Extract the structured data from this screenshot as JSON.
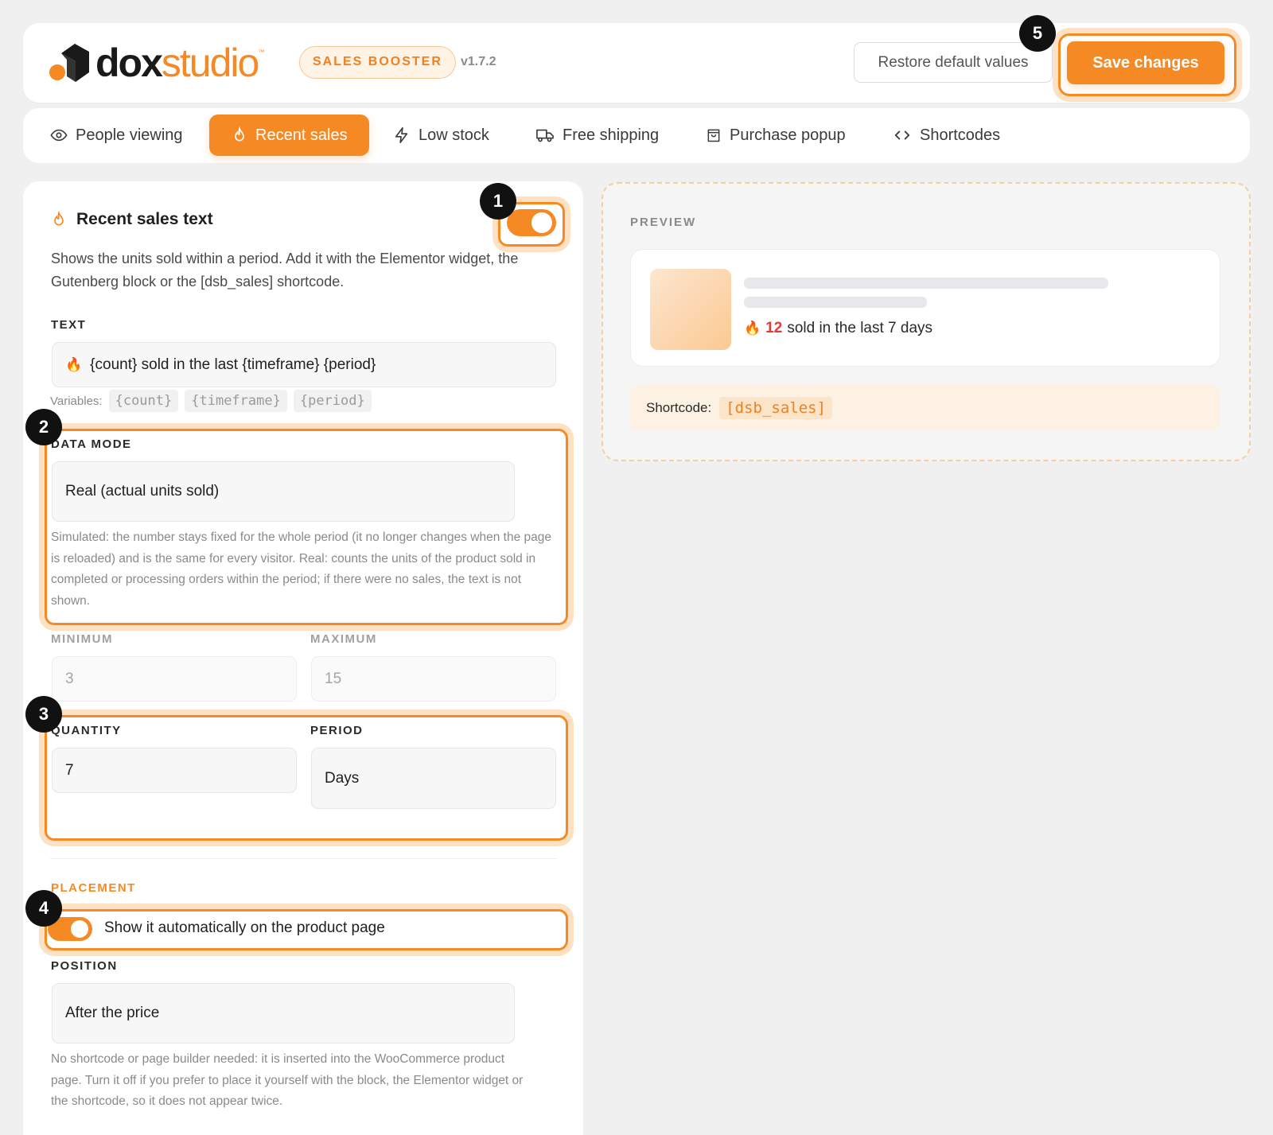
{
  "header": {
    "logo_dox": "dox",
    "logo_studio": "studio",
    "badge": "SALES BOOSTER",
    "version": "v1.7.2",
    "restore_label": "Restore default values",
    "save_label": "Save changes",
    "save_step": "5"
  },
  "tabs": [
    {
      "label": "People viewing",
      "icon": "eye-icon"
    },
    {
      "label": "Recent sales",
      "icon": "flame-icon",
      "active": true
    },
    {
      "label": "Low stock",
      "icon": "bolt-icon"
    },
    {
      "label": "Free shipping",
      "icon": "truck-icon"
    },
    {
      "label": "Purchase popup",
      "icon": "bag-icon"
    },
    {
      "label": "Shortcodes",
      "icon": "code-icon"
    }
  ],
  "settings": {
    "title": "Recent sales text",
    "toggle_step": "1",
    "enabled": true,
    "description": "Shows the units sold within a period. Add it with the Elementor widget, the Gutenberg block or the [dsb_sales] shortcode.",
    "text_label": "TEXT",
    "text_emoji": "🔥",
    "text_value": "{count} sold in the last {timeframe} {period}",
    "variables_label": "Variables:",
    "variables": [
      "{count}",
      "{timeframe}",
      "{period}"
    ],
    "data_mode": {
      "step": "2",
      "label": "DATA MODE",
      "value": "Real (actual units sold)",
      "help": "Simulated: the number stays fixed for the whole period (it no longer changes when the page is reloaded) and is the same for every visitor. Real: counts the units of the product sold in completed or processing orders within the period; if there were no sales, the text is not shown."
    },
    "minimum": {
      "label": "MINIMUM",
      "value": "3"
    },
    "maximum": {
      "label": "MAXIMUM",
      "value": "15"
    },
    "quantity": {
      "step": "3",
      "label": "QUANTITY",
      "value": "7"
    },
    "period": {
      "label": "PERIOD",
      "value": "Days"
    },
    "placement": {
      "label": "PLACEMENT",
      "step": "4",
      "auto_label": "Show it automatically on the product page",
      "auto_enabled": true
    },
    "position": {
      "label": "POSITION",
      "value": "After the price",
      "help": "No shortcode or page builder needed: it is inserted into the WooCommerce product page. Turn it off if you prefer to place it yourself with the block, the Elementor widget or the shortcode, so it does not appear twice."
    }
  },
  "preview": {
    "label": "PREVIEW",
    "emoji": "🔥",
    "count": "12",
    "text": "sold in the last 7 days",
    "shortcode_label": "Shortcode:",
    "shortcode": "[dsb_sales]"
  },
  "colors": {
    "accent": "#f58a25",
    "accent_soft": "#fde1c2",
    "count_red": "#e53935",
    "background": "#f0f0f0"
  }
}
